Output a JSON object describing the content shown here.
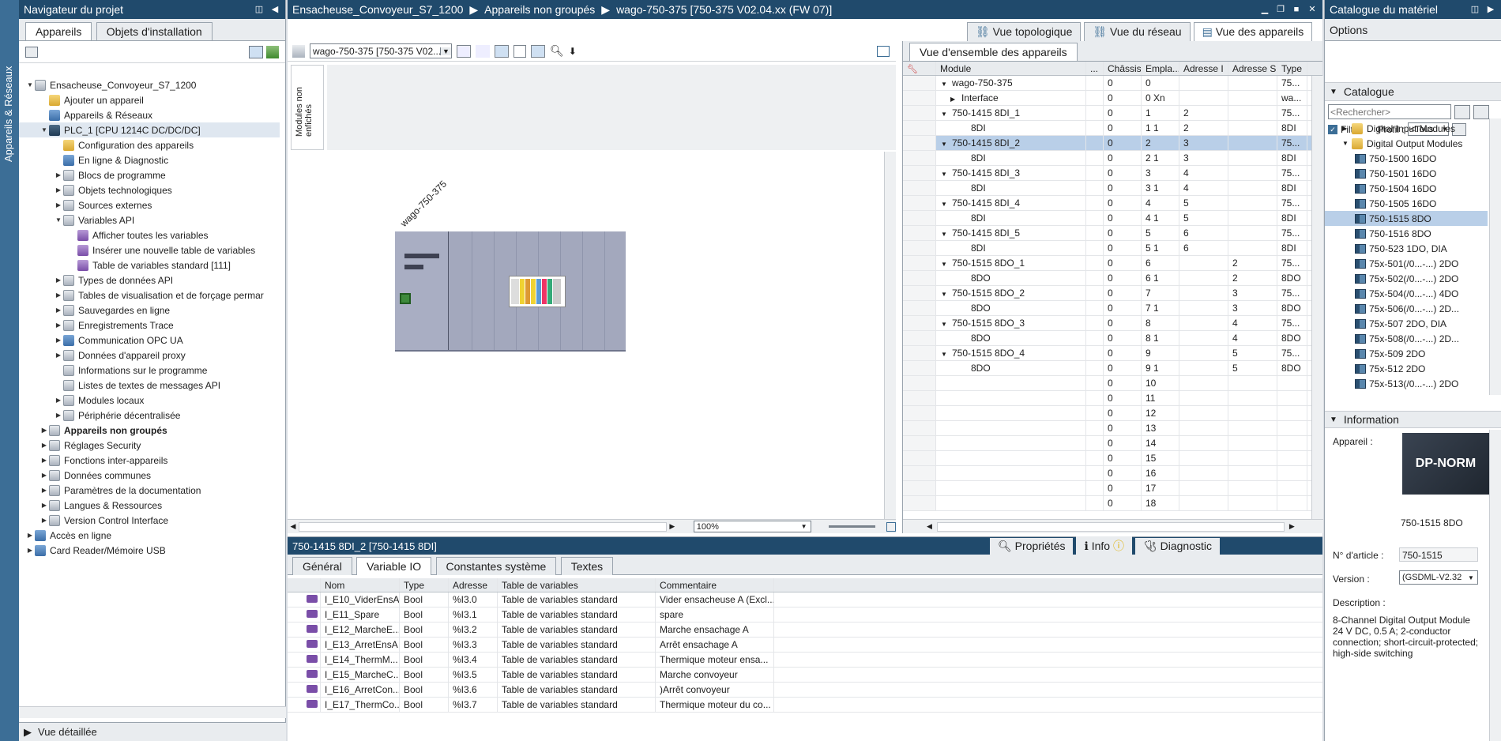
{
  "left_vtab": {
    "label": "Appareils & Réseaux"
  },
  "project_nav": {
    "title": "Navigateur du projet",
    "tabs": [
      "Appareils",
      "Objets d'installation"
    ],
    "tree": [
      {
        "label": "Ensacheuse_Convoyeur_S7_1200",
        "indent": 0,
        "arrow": "▼",
        "icon": "gray"
      },
      {
        "label": "Ajouter un appareil",
        "indent": 1,
        "arrow": "",
        "icon": "yellow"
      },
      {
        "label": "Appareils & Réseaux",
        "indent": 1,
        "arrow": "",
        "icon": "blue"
      },
      {
        "label": "PLC_1 [CPU 1214C DC/DC/DC]",
        "indent": 1,
        "arrow": "▼",
        "icon": "dark",
        "selected": true
      },
      {
        "label": "Configuration des appareils",
        "indent": 2,
        "arrow": "",
        "icon": "yellow"
      },
      {
        "label": "En ligne & Diagnostic",
        "indent": 2,
        "arrow": "",
        "icon": "blue"
      },
      {
        "label": "Blocs de programme",
        "indent": 2,
        "arrow": "▶",
        "icon": "gray"
      },
      {
        "label": "Objets technologiques",
        "indent": 2,
        "arrow": "▶",
        "icon": "gray"
      },
      {
        "label": "Sources externes",
        "indent": 2,
        "arrow": "▶",
        "icon": "gray"
      },
      {
        "label": "Variables API",
        "indent": 2,
        "arrow": "▼",
        "icon": "gray"
      },
      {
        "label": "Afficher toutes les variables",
        "indent": 3,
        "arrow": "",
        "icon": "purple"
      },
      {
        "label": "Insérer une nouvelle table de variables",
        "indent": 3,
        "arrow": "",
        "icon": "purple"
      },
      {
        "label": "Table de variables standard [111]",
        "indent": 3,
        "arrow": "",
        "icon": "purple"
      },
      {
        "label": "Types de données API",
        "indent": 2,
        "arrow": "▶",
        "icon": "gray"
      },
      {
        "label": "Tables de visualisation et de forçage permar",
        "indent": 2,
        "arrow": "▶",
        "icon": "gray"
      },
      {
        "label": "Sauvegardes en ligne",
        "indent": 2,
        "arrow": "▶",
        "icon": "gray"
      },
      {
        "label": "Enregistrements Trace",
        "indent": 2,
        "arrow": "▶",
        "icon": "gray"
      },
      {
        "label": "Communication OPC UA",
        "indent": 2,
        "arrow": "▶",
        "icon": "blue"
      },
      {
        "label": "Données d'appareil proxy",
        "indent": 2,
        "arrow": "▶",
        "icon": "gray"
      },
      {
        "label": "Informations sur le programme",
        "indent": 2,
        "arrow": "",
        "icon": "gray"
      },
      {
        "label": "Listes de textes de messages API",
        "indent": 2,
        "arrow": "",
        "icon": "gray"
      },
      {
        "label": "Modules locaux",
        "indent": 2,
        "arrow": "▶",
        "icon": "gray"
      },
      {
        "label": "Périphérie décentralisée",
        "indent": 2,
        "arrow": "▶",
        "icon": "gray"
      },
      {
        "label": "Appareils non groupés",
        "indent": 1,
        "arrow": "▶",
        "icon": "gray",
        "bold": true
      },
      {
        "label": "Réglages Security",
        "indent": 1,
        "arrow": "▶",
        "icon": "gray"
      },
      {
        "label": "Fonctions inter-appareils",
        "indent": 1,
        "arrow": "▶",
        "icon": "gray"
      },
      {
        "label": "Données communes",
        "indent": 1,
        "arrow": "▶",
        "icon": "gray"
      },
      {
        "label": "Paramètres de la documentation",
        "indent": 1,
        "arrow": "▶",
        "icon": "gray"
      },
      {
        "label": "Langues & Ressources",
        "indent": 1,
        "arrow": "▶",
        "icon": "gray"
      },
      {
        "label": "Version Control Interface",
        "indent": 1,
        "arrow": "▶",
        "icon": "gray"
      },
      {
        "label": "Accès en ligne",
        "indent": 0,
        "arrow": "▶",
        "icon": "blue"
      },
      {
        "label": "Card Reader/Mémoire USB",
        "indent": 0,
        "arrow": "▶",
        "icon": "blue"
      }
    ],
    "detail_view": "Vue détaillée"
  },
  "editor": {
    "breadcrumb": [
      "Ensacheuse_Convoyeur_S7_1200",
      "Appareils non groupés",
      "wago-750-375 [750-375 V02.04.xx (FW 07)]"
    ],
    "view_tabs": [
      "Vue topologique",
      "Vue du réseau",
      "Vue des appareils"
    ],
    "device_select": "wago-750-375 [750-375 V02...",
    "unplugged_label": "Modules non enfichés",
    "rack_label": "wago-750-375",
    "zoom": "100%"
  },
  "overview": {
    "tab": "Vue d'ensemble des appareils",
    "columns": [
      "Module",
      "...",
      "Châssis",
      "Empla...",
      "Adresse I",
      "Adresse S",
      "Type"
    ],
    "rows": [
      {
        "module": "wago-750-375",
        "indent": 0,
        "arrow": "▼",
        "chassis": "0",
        "slot": "0",
        "addr_i": "",
        "addr_s": "",
        "type": "75..."
      },
      {
        "module": "Interface",
        "indent": 1,
        "arrow": "▶",
        "chassis": "0",
        "slot": "0 Xn",
        "addr_i": "",
        "addr_s": "",
        "type": "wa..."
      },
      {
        "module": "750-1415 8DI_1",
        "indent": 0,
        "arrow": "▼",
        "chassis": "0",
        "slot": "1",
        "addr_i": "2",
        "addr_s": "",
        "type": "75..."
      },
      {
        "module": "8DI",
        "indent": 2,
        "arrow": "",
        "chassis": "0",
        "slot": "1 1",
        "addr_i": "2",
        "addr_s": "",
        "type": "8DI"
      },
      {
        "module": "750-1415 8DI_2",
        "indent": 0,
        "arrow": "▼",
        "chassis": "0",
        "slot": "2",
        "addr_i": "3",
        "addr_s": "",
        "type": "75...",
        "selected": true
      },
      {
        "module": "8DI",
        "indent": 2,
        "arrow": "",
        "chassis": "0",
        "slot": "2 1",
        "addr_i": "3",
        "addr_s": "",
        "type": "8DI"
      },
      {
        "module": "750-1415 8DI_3",
        "indent": 0,
        "arrow": "▼",
        "chassis": "0",
        "slot": "3",
        "addr_i": "4",
        "addr_s": "",
        "type": "75..."
      },
      {
        "module": "8DI",
        "indent": 2,
        "arrow": "",
        "chassis": "0",
        "slot": "3 1",
        "addr_i": "4",
        "addr_s": "",
        "type": "8DI"
      },
      {
        "module": "750-1415 8DI_4",
        "indent": 0,
        "arrow": "▼",
        "chassis": "0",
        "slot": "4",
        "addr_i": "5",
        "addr_s": "",
        "type": "75..."
      },
      {
        "module": "8DI",
        "indent": 2,
        "arrow": "",
        "chassis": "0",
        "slot": "4 1",
        "addr_i": "5",
        "addr_s": "",
        "type": "8DI"
      },
      {
        "module": "750-1415 8DI_5",
        "indent": 0,
        "arrow": "▼",
        "chassis": "0",
        "slot": "5",
        "addr_i": "6",
        "addr_s": "",
        "type": "75..."
      },
      {
        "module": "8DI",
        "indent": 2,
        "arrow": "",
        "chassis": "0",
        "slot": "5 1",
        "addr_i": "6",
        "addr_s": "",
        "type": "8DI"
      },
      {
        "module": "750-1515 8DO_1",
        "indent": 0,
        "arrow": "▼",
        "chassis": "0",
        "slot": "6",
        "addr_i": "",
        "addr_s": "2",
        "type": "75..."
      },
      {
        "module": "8DO",
        "indent": 2,
        "arrow": "",
        "chassis": "0",
        "slot": "6 1",
        "addr_i": "",
        "addr_s": "2",
        "type": "8DO"
      },
      {
        "module": "750-1515 8DO_2",
        "indent": 0,
        "arrow": "▼",
        "chassis": "0",
        "slot": "7",
        "addr_i": "",
        "addr_s": "3",
        "type": "75..."
      },
      {
        "module": "8DO",
        "indent": 2,
        "arrow": "",
        "chassis": "0",
        "slot": "7 1",
        "addr_i": "",
        "addr_s": "3",
        "type": "8DO"
      },
      {
        "module": "750-1515 8DO_3",
        "indent": 0,
        "arrow": "▼",
        "chassis": "0",
        "slot": "8",
        "addr_i": "",
        "addr_s": "4",
        "type": "75..."
      },
      {
        "module": "8DO",
        "indent": 2,
        "arrow": "",
        "chassis": "0",
        "slot": "8 1",
        "addr_i": "",
        "addr_s": "4",
        "type": "8DO"
      },
      {
        "module": "750-1515 8DO_4",
        "indent": 0,
        "arrow": "▼",
        "chassis": "0",
        "slot": "9",
        "addr_i": "",
        "addr_s": "5",
        "type": "75..."
      },
      {
        "module": "8DO",
        "indent": 2,
        "arrow": "",
        "chassis": "0",
        "slot": "9 1",
        "addr_i": "",
        "addr_s": "5",
        "type": "8DO"
      },
      {
        "module": "",
        "indent": 0,
        "arrow": "",
        "chassis": "0",
        "slot": "10",
        "addr_i": "",
        "addr_s": "",
        "type": ""
      },
      {
        "module": "",
        "indent": 0,
        "arrow": "",
        "chassis": "0",
        "slot": "11",
        "addr_i": "",
        "addr_s": "",
        "type": ""
      },
      {
        "module": "",
        "indent": 0,
        "arrow": "",
        "chassis": "0",
        "slot": "12",
        "addr_i": "",
        "addr_s": "",
        "type": ""
      },
      {
        "module": "",
        "indent": 0,
        "arrow": "",
        "chassis": "0",
        "slot": "13",
        "addr_i": "",
        "addr_s": "",
        "type": ""
      },
      {
        "module": "",
        "indent": 0,
        "arrow": "",
        "chassis": "0",
        "slot": "14",
        "addr_i": "",
        "addr_s": "",
        "type": ""
      },
      {
        "module": "",
        "indent": 0,
        "arrow": "",
        "chassis": "0",
        "slot": "15",
        "addr_i": "",
        "addr_s": "",
        "type": ""
      },
      {
        "module": "",
        "indent": 0,
        "arrow": "",
        "chassis": "0",
        "slot": "16",
        "addr_i": "",
        "addr_s": "",
        "type": ""
      },
      {
        "module": "",
        "indent": 0,
        "arrow": "",
        "chassis": "0",
        "slot": "17",
        "addr_i": "",
        "addr_s": "",
        "type": ""
      },
      {
        "module": "",
        "indent": 0,
        "arrow": "",
        "chassis": "0",
        "slot": "18",
        "addr_i": "",
        "addr_s": "",
        "type": ""
      }
    ]
  },
  "inspector": {
    "title": "750-1415 8DI_2 [750-1415 8DI]",
    "top_tabs": [
      "Propriétés",
      "Info",
      "Diagnostic"
    ],
    "sub_tabs": [
      "Général",
      "Variable IO",
      "Constantes système",
      "Textes"
    ],
    "columns": [
      "Nom",
      "Type",
      "Adresse",
      "Table de variables",
      "Commentaire"
    ],
    "rows": [
      {
        "name": "I_E10_ViderEnsA",
        "type": "Bool",
        "addr": "%I3.0",
        "table": "Table de variables standard",
        "comment": "Vider ensacheuse A (Excl..."
      },
      {
        "name": "I_E11_Spare",
        "type": "Bool",
        "addr": "%I3.1",
        "table": "Table de variables standard",
        "comment": "spare"
      },
      {
        "name": "I_E12_MarcheE...",
        "type": "Bool",
        "addr": "%I3.2",
        "table": "Table de variables standard",
        "comment": "Marche ensachage A"
      },
      {
        "name": "I_E13_ArretEnsA",
        "type": "Bool",
        "addr": "%I3.3",
        "table": "Table de variables standard",
        "comment": "Arrêt ensachage A"
      },
      {
        "name": "I_E14_ThermM...",
        "type": "Bool",
        "addr": "%I3.4",
        "table": "Table de variables standard",
        "comment": "Thermique moteur ensa..."
      },
      {
        "name": "I_E15_MarcheC...",
        "type": "Bool",
        "addr": "%I3.5",
        "table": "Table de variables standard",
        "comment": "Marche convoyeur"
      },
      {
        "name": "I_E16_ArretCon...",
        "type": "Bool",
        "addr": "%I3.6",
        "table": "Table de variables standard",
        "comment": ")Arrêt convoyeur"
      },
      {
        "name": "I_E17_ThermCo...",
        "type": "Bool",
        "addr": "%I3.7",
        "table": "Table de variables standard",
        "comment": "Thermique moteur du co..."
      }
    ]
  },
  "catalog": {
    "title": "Catalogue du matériel",
    "options": "Options",
    "section": "Catalogue",
    "search_placeholder": "<Rechercher>",
    "filter_label": "Filtre",
    "profile_label": "Profil :",
    "profile_value": "<Tous",
    "items": [
      {
        "label": "Digital Input Modules",
        "folder": true,
        "arrow": "▶",
        "indent": 1
      },
      {
        "label": "Digital Output Modules",
        "folder": true,
        "arrow": "▼",
        "indent": 1
      },
      {
        "label": "750-1500 16DO",
        "indent": 2
      },
      {
        "label": "750-1501 16DO",
        "indent": 2
      },
      {
        "label": "750-1504 16DO",
        "indent": 2
      },
      {
        "label": "750-1505 16DO",
        "indent": 2
      },
      {
        "label": "750-1515 8DO",
        "indent": 2,
        "selected": true
      },
      {
        "label": "750-1516 8DO",
        "indent": 2
      },
      {
        "label": "750-523 1DO, DIA",
        "indent": 2
      },
      {
        "label": "75x-501(/0...-...) 2DO",
        "indent": 2
      },
      {
        "label": "75x-502(/0...-...) 2DO",
        "indent": 2
      },
      {
        "label": "75x-504(/0...-...) 4DO",
        "indent": 2
      },
      {
        "label": "75x-506(/0...-...) 2D...",
        "indent": 2
      },
      {
        "label": "75x-507 2DO, DIA",
        "indent": 2
      },
      {
        "label": "75x-508(/0...-...) 2D...",
        "indent": 2
      },
      {
        "label": "75x-509 2DO",
        "indent": 2
      },
      {
        "label": "75x-512 2DO",
        "indent": 2
      },
      {
        "label": "75x-513(/0...-...) 2DO",
        "indent": 2
      }
    ],
    "info_section": "Information",
    "device_label": "Appareil :",
    "device_image_text": "DP-NORM",
    "device_name": "750-1515 8DO",
    "article_label": "N° d'article :",
    "article_value": "750-1515",
    "version_label": "Version :",
    "version_value": "(GSDML-V2.32",
    "description_label": "Description :",
    "description": "8-Channel Digital Output Module 24 V DC, 0.5 A; 2-conductor connection; short-circuit-protected; high-side switching"
  },
  "colors": {
    "title_bar": "#204a6c",
    "accent": "#3c6e96",
    "selection": "#b9cfe8"
  }
}
